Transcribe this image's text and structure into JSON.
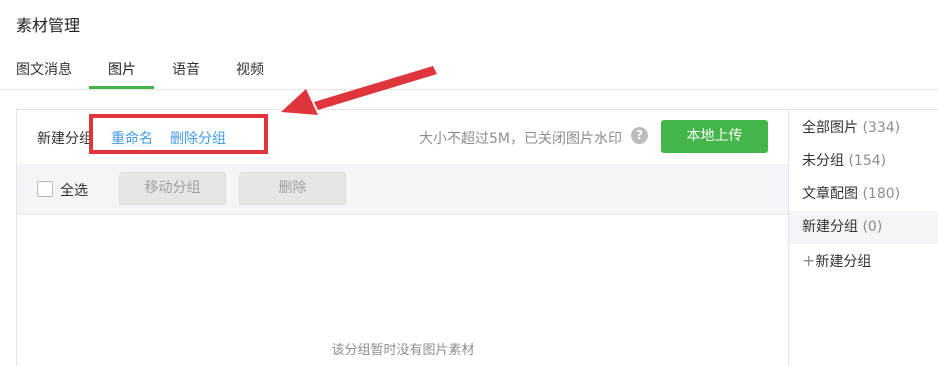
{
  "page_title": "素材管理",
  "tabs": [
    {
      "label": "图文消息",
      "active": false
    },
    {
      "label": "图片",
      "active": true
    },
    {
      "label": "语音",
      "active": false
    },
    {
      "label": "视频",
      "active": false
    }
  ],
  "group_bar": {
    "group_name": "新建分组",
    "rename_link": "重命名",
    "delete_group_link": "删除分组",
    "hint": "大小不超过5M，已关闭图片水印",
    "help_icon": "?",
    "upload_button": "本地上传"
  },
  "toolbar": {
    "select_all": "全选",
    "move_group_button": "移动分组",
    "delete_button": "删除"
  },
  "empty_message": "该分组暂时没有图片素材",
  "sidebar": {
    "items": [
      {
        "label": "全部图片",
        "count": "(334)",
        "selected": false
      },
      {
        "label": "未分组",
        "count": "(154)",
        "selected": false
      },
      {
        "label": "文章配图",
        "count": "(180)",
        "selected": false
      },
      {
        "label": "新建分组",
        "count": "(0)",
        "selected": true
      }
    ],
    "add_group": "新建分组",
    "add_icon": "+"
  },
  "colors": {
    "accent_green": "#44b549",
    "link_blue": "#459ae9",
    "annotation_red": "#e0353c"
  }
}
